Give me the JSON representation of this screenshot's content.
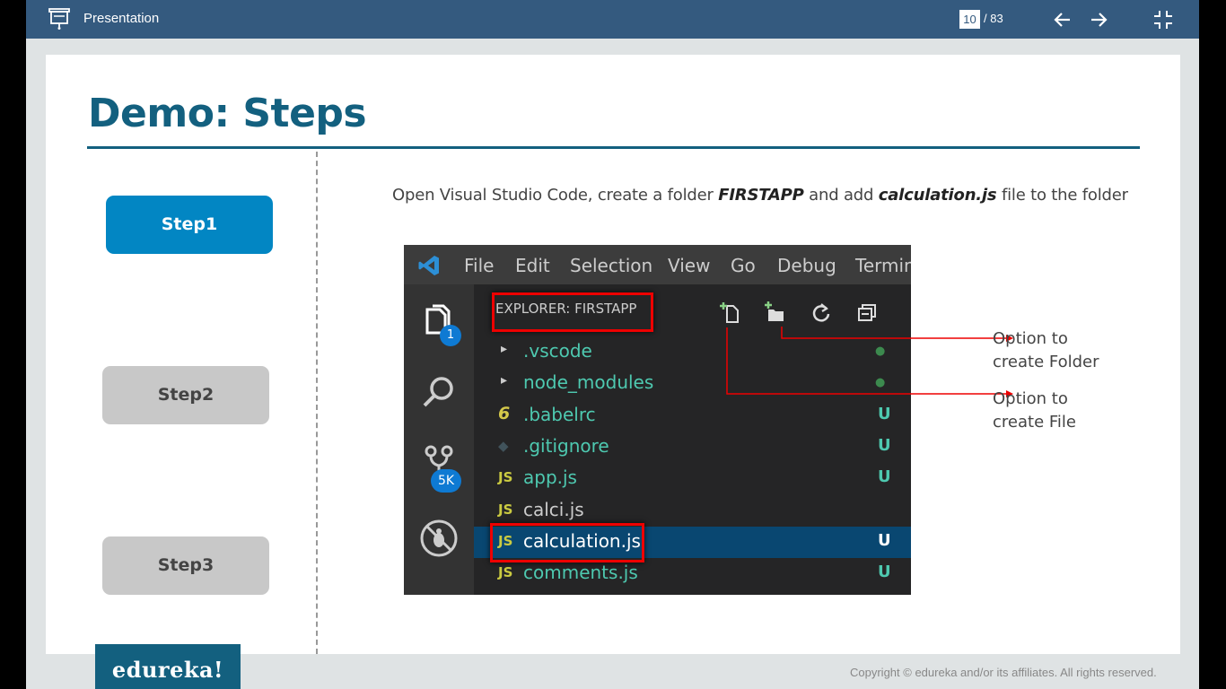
{
  "topbar": {
    "title": "Presentation",
    "page_current": "10",
    "page_total": "/ 83",
    "icons": [
      "presentation-icon",
      "arrow-left-icon",
      "arrow-right-icon",
      "exit-fullscreen-icon"
    ]
  },
  "slide": {
    "title": "Demo: Steps",
    "steps": [
      {
        "label": "Step1",
        "state": "active"
      },
      {
        "label": "Step2",
        "state": "inactive"
      },
      {
        "label": "Step3",
        "state": "inactive"
      }
    ],
    "instruction": {
      "part1": "Open Visual Studio Code, create a folder ",
      "folder": "FIRSTAPP",
      "part2": " and add ",
      "file": "calculation.js",
      "part3": " file to the folder"
    },
    "callouts": {
      "folder_line1": "Option to",
      "folder_line2": "create Folder",
      "file_line1": "Option to",
      "file_line2": "create File"
    }
  },
  "vscode": {
    "menu": [
      "File",
      "Edit",
      "Selection",
      "View",
      "Go",
      "Debug",
      "Terminal"
    ],
    "explorer_header": "EXPLORER: FIRSTAPP",
    "badges": {
      "explorer": "1",
      "scm": "5K"
    },
    "files": [
      {
        "icon": "▸",
        "name": ".vscode",
        "status": "●",
        "color": "#4ec9b0",
        "icon_color": "#ccc",
        "status_color": "#3c8a4e"
      },
      {
        "icon": "▸",
        "name": "node_modules",
        "status": "●",
        "color": "#4ec9b0",
        "icon_color": "#ccc",
        "status_color": "#3c8a4e"
      },
      {
        "icon": "6",
        "name": ".babelrc",
        "status": "U",
        "color": "#4ec9b0",
        "icon_color": "#d4c84a",
        "status_color": "#4ec9b0"
      },
      {
        "icon": "◆",
        "name": ".gitignore",
        "status": "U",
        "color": "#4ec9b0",
        "icon_color": "#41535b",
        "status_color": "#4ec9b0"
      },
      {
        "icon": "JS",
        "name": "app.js",
        "status": "U",
        "color": "#4ec9b0",
        "icon_color": "#cbcb41",
        "status_color": "#4ec9b0"
      },
      {
        "icon": "JS",
        "name": "calci.js",
        "status": "",
        "color": "#cccccc",
        "icon_color": "#cbcb41",
        "status_color": "#4ec9b0"
      },
      {
        "icon": "JS",
        "name": "calculation.js",
        "status": "U",
        "color": "#ffffff",
        "icon_color": "#cbcb41",
        "status_color": "#ffffff",
        "selected": true
      },
      {
        "icon": "JS",
        "name": "comments.js",
        "status": "U",
        "color": "#4ec9b0",
        "icon_color": "#cbcb41",
        "status_color": "#4ec9b0"
      }
    ]
  },
  "footer": {
    "logo": "edureka!",
    "copyright": "Copyright © edureka and/or its affiliates. All rights reserved."
  },
  "colors": {
    "topbar": "#345a7f",
    "title": "#13607f",
    "step_active": "#0286c3",
    "step_inactive": "#c8c8c8",
    "highlight": "#e00000",
    "vscode_bg": "#252526"
  }
}
